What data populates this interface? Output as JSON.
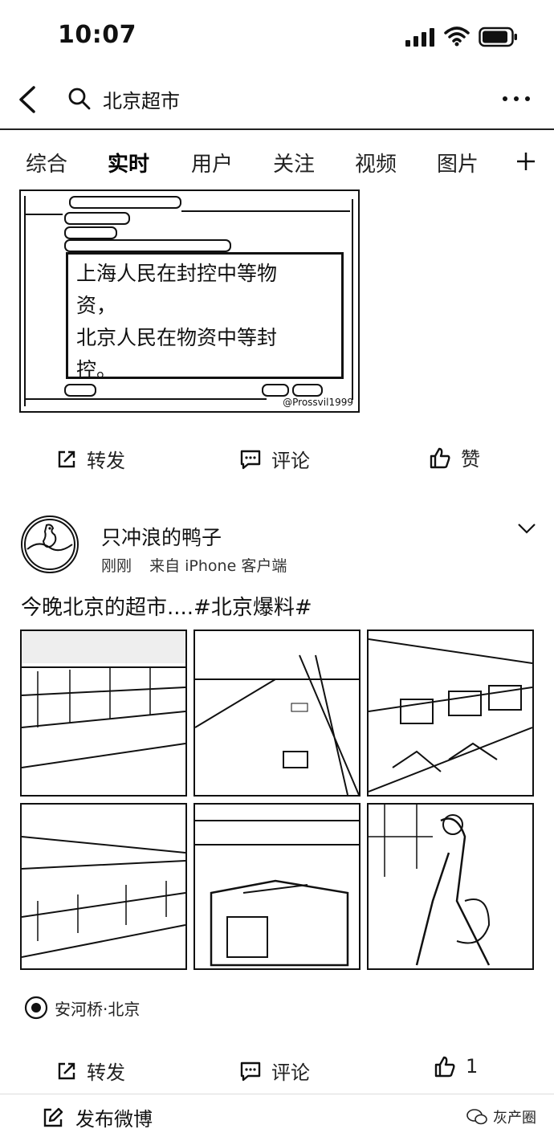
{
  "status_bar": {
    "time": "10:07"
  },
  "search": {
    "query": "北京超市"
  },
  "tabs": [
    {
      "label": "综合"
    },
    {
      "label": "实时"
    },
    {
      "label": "用户"
    },
    {
      "label": "关注"
    },
    {
      "label": "视频"
    },
    {
      "label": "图片"
    }
  ],
  "active_tab": "实时",
  "post1": {
    "image_quote": "上海人民在封控中等物\n资，\n北京人民在物资中等封\n控。",
    "image_watermark": "@Prossvil1999",
    "actions": {
      "repost": "转发",
      "comment": "评论",
      "like": "赞"
    }
  },
  "post2": {
    "author": "只冲浪的鸭子",
    "time": "刚刚",
    "source": "来自 iPhone 客户端",
    "text": "今晚北京的超市....#北京爆料#",
    "location": "安河桥·北京",
    "actions": {
      "repost": "转发",
      "comment": "评论",
      "like_count": "1"
    }
  },
  "compose": {
    "label": "发布微博"
  },
  "brand_watermark": "灰产圈"
}
